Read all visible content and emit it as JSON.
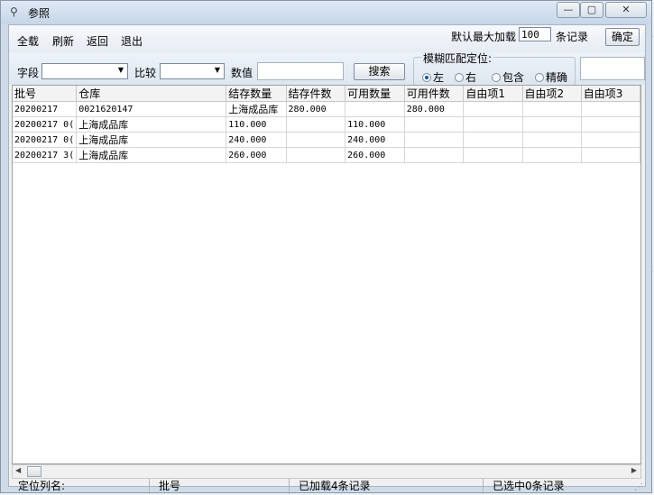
{
  "window": {
    "title": "参照",
    "title_icon": "reference-icon"
  },
  "toolbar": {
    "select_all": "全载",
    "refresh": "刷新",
    "back": "返回",
    "exit": "退出",
    "max_load_label": "默认最大加载",
    "max_load_value": "100",
    "records_label": "条记录",
    "confirm": "确定"
  },
  "search": {
    "field_label": "字段",
    "field_value": "",
    "compare_label": "比较",
    "compare_value": "",
    "value_label": "数值",
    "value_input": "",
    "search_button": "搜索",
    "fuzzy_label": "模糊匹配定位:",
    "options": [
      "左",
      "右",
      "包含",
      "精确"
    ],
    "selected_option": "左"
  },
  "grid": {
    "columns": [
      "批号",
      "仓库",
      "结存数量",
      "结存件数",
      "可用数量",
      "可用件数",
      "自由项1",
      "自由项2",
      "自由项3"
    ],
    "rows": [
      [
        "20200217",
        "0021620147",
        "上海成品库",
        "280.000",
        "",
        "280.000",
        "",
        "",
        ""
      ],
      [
        "20200217 0(",
        "上海成品库",
        "110.000",
        "",
        "110.000",
        "",
        "",
        "",
        ""
      ],
      [
        "20200217 0(",
        "上海成品库",
        "240.000",
        "",
        "240.000",
        "",
        "",
        "",
        ""
      ],
      [
        "20200217 3(",
        "上海成品库",
        "260.000",
        "",
        "260.000",
        "",
        "",
        "",
        ""
      ]
    ]
  },
  "status": {
    "locate_label": "定位列名:",
    "locate_value": "批号",
    "loaded": "已加载4条记录",
    "selected": "已选中0条记录"
  }
}
